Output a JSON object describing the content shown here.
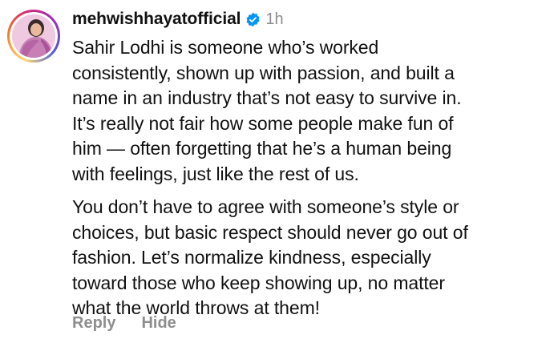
{
  "comment": {
    "username": "mehwishhayatofficial",
    "timestamp": "1h",
    "verified_icon": "verified-badge-icon",
    "paragraphs": [
      "Sahir Lodhi is someone who’s worked\nconsistently, shown up with passion, and built a\nname in an industry that’s not easy to survive in.\nIt’s really not fair how some people make fun of\nhim — often forgetting that he’s a human being\nwith feelings, just like the rest of us.",
      "You don’t have to agree with someone’s style or\nchoices, but basic respect should never go out of\nfashion. Let’s normalize kindness, especially\ntoward those who keep showing up, no matter\nwhat the world throws at them!"
    ],
    "actions": {
      "reply_label": "Reply",
      "hide_label": "Hide"
    }
  },
  "colors": {
    "text": "#111111",
    "secondary": "#8e8e8e",
    "verified": "#0095f6"
  }
}
